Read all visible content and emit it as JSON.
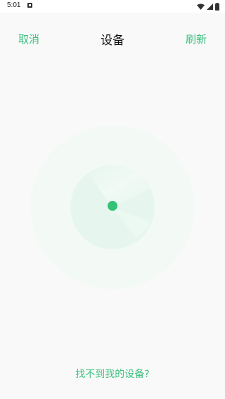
{
  "status_bar": {
    "time": "5:01"
  },
  "header": {
    "cancel_label": "取消",
    "title": "设备",
    "refresh_label": "刷新"
  },
  "footer": {
    "not_found_label": "找不到我的设备?"
  },
  "colors": {
    "accent": "#3dbf7f",
    "dot": "#35c277",
    "radar_outer": "#f3faf6",
    "radar_inner": "#e6f6ee"
  }
}
